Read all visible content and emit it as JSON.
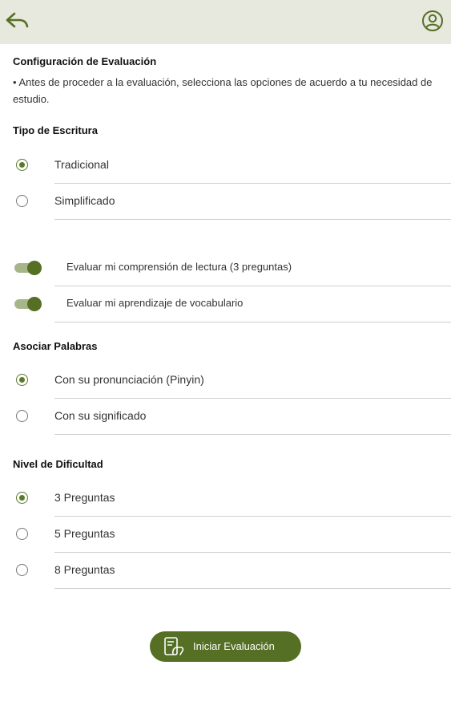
{
  "icons": {
    "back": "reply-arrow-icon",
    "user": "user-circle-icon",
    "start": "document-hand-icon"
  },
  "colors": {
    "accent": "#556f24",
    "accent_light": "#a6b68a",
    "topbar": "#e7e8de"
  },
  "config": {
    "title": "Configuración de Evaluación",
    "intro": "• Antes de proceder a la evaluación, selecciona las opciones de acuerdo a tu necesidad de estudio."
  },
  "writing": {
    "title": "Tipo de Escritura",
    "options": [
      {
        "label": "Tradicional",
        "selected": true
      },
      {
        "label": "Simplificado",
        "selected": false
      }
    ]
  },
  "toggles": [
    {
      "label": "Evaluar mi comprensión de lectura (3 preguntas)",
      "on": true
    },
    {
      "label": "Evaluar mi aprendizaje de vocabulario",
      "on": true
    }
  ],
  "associate": {
    "title": "Asociar Palabras",
    "options": [
      {
        "label": "Con su pronunciación (Pinyin)",
        "selected": true
      },
      {
        "label": "Con su significado",
        "selected": false
      }
    ]
  },
  "difficulty": {
    "title": "Nivel de Dificultad",
    "options": [
      {
        "label": "3 Preguntas",
        "selected": true
      },
      {
        "label": "5 Preguntas",
        "selected": false
      },
      {
        "label": "8 Preguntas",
        "selected": false
      }
    ]
  },
  "start_button": {
    "label": "Iniciar Evaluación"
  }
}
